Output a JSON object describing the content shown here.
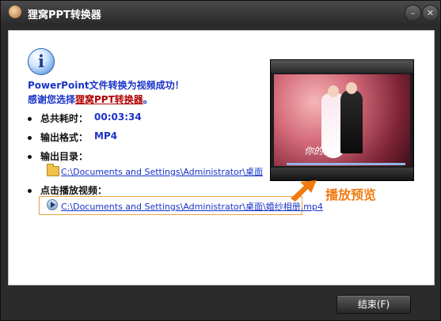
{
  "window": {
    "title": "狸窝PPT转换器",
    "minimize_symbol": "–",
    "close_symbol": "✕"
  },
  "message": {
    "line1": "PowerPoint文件转换为视频成功！",
    "line2_prefix": "感谢您选择",
    "line2_product": "狸窝PPT转换器",
    "line2_suffix": "。"
  },
  "details": {
    "total_time_label": "总共耗时：",
    "total_time_value": "00:03:34",
    "output_format_label": "输出格式：",
    "output_format_value": "MP4",
    "output_dir_label": "输出目录：",
    "output_dir_path": "C:\\Documents and Settings\\Administrator\\桌面",
    "play_label": "点击播放视频：",
    "play_path": "C:\\Documents and Settings\\Administrator\\桌面\\婚纱相册.mp4"
  },
  "preview": {
    "overlay_text": "你的爱",
    "label": "播放预览"
  },
  "footer": {
    "finish_button": "结束(F)"
  },
  "colors": {
    "accent_blue": "#1a33c8",
    "accent_orange": "#f07b12",
    "product_red": "#b00000"
  }
}
